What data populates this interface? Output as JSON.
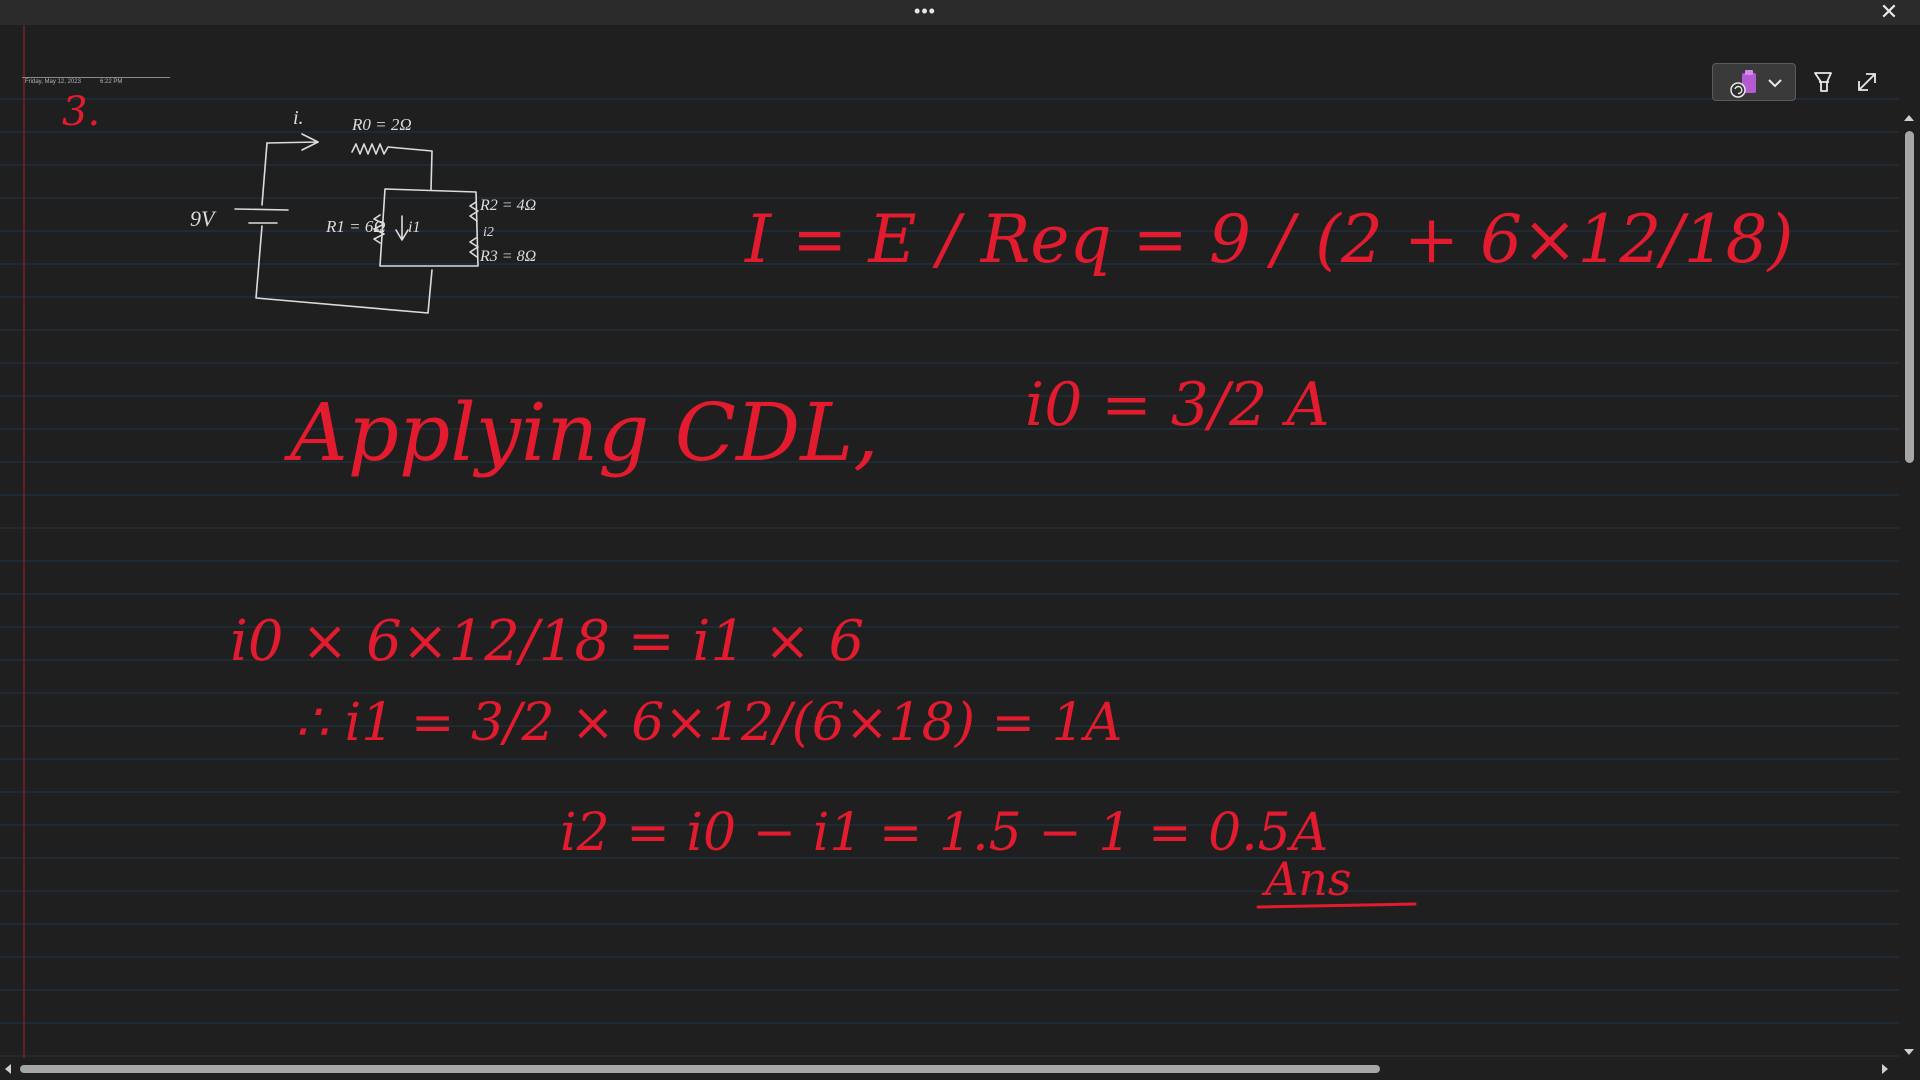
{
  "titlebar": {
    "more_label": "•••",
    "close_label": "✕"
  },
  "page": {
    "date": "Friday, May 12, 2023",
    "time": "6:22 PM"
  },
  "toolbar": {
    "pen_icon": "pen-tool-icon",
    "dropdown_icon": "chevron-down-icon",
    "highlighter_icon": "highlighter-icon",
    "expand_icon": "expand-icon"
  },
  "colors": {
    "background": "#1f1f1f",
    "rule_line": "#22344a",
    "margin_line": "#7a1f28",
    "ink_red": "#e31b2e",
    "ink_white": "#dcdcdc",
    "pen_tool_accent": "#b45bd4"
  },
  "handwriting": {
    "problem_number": "3.",
    "circuit": {
      "source": "9V",
      "current_i0": "i.",
      "r0": "R0 = 2Ω",
      "r1": "R1 = 6Ω",
      "r2": "R2 = 4Ω",
      "r3": "R3 = 8Ω",
      "current_i1": "i1",
      "current_i2": "i2"
    },
    "equation_current": "I = E / Req = 9 / (2 + 6×12/18)",
    "result_i0": "i0 = 3/2 A",
    "method": "Applying CDL,",
    "cdl_line": "i0 × 6×12/18 = i1 × 6",
    "i1_line": "∴ i1 = 3/2 × 6×12/(6×18) = 1A",
    "i2_line": "i2 = i0 − i1 = 1.5 − 1 = 0.5A",
    "answer": "Ans"
  }
}
